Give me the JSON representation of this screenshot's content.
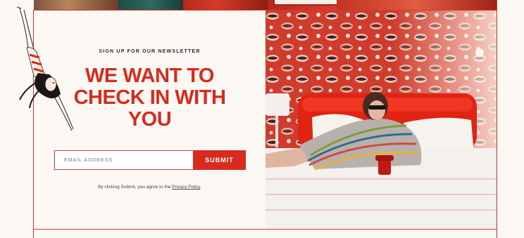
{
  "newsletter": {
    "eyebrow": "SIGN UP FOR OUR NEWSLETTER",
    "headline_line1": "WE WANT TO",
    "headline_line2": "CHECK IN WITH",
    "headline_line3": "YOU",
    "email_placeholder": "EMAIL ADDRESS",
    "email_value": "",
    "submit_label": "SUBMIT",
    "legal_prefix": "By clicking Submit, you agree to the ",
    "legal_link": "Privacy Policy",
    "legal_suffix": "."
  },
  "colors": {
    "accent": "#d72b20",
    "background": "#fbf8f3",
    "text": "#2a2a2a"
  },
  "icons": {
    "diver": "diver-illustration",
    "photo": "woman-on-red-bed-with-telephone"
  }
}
